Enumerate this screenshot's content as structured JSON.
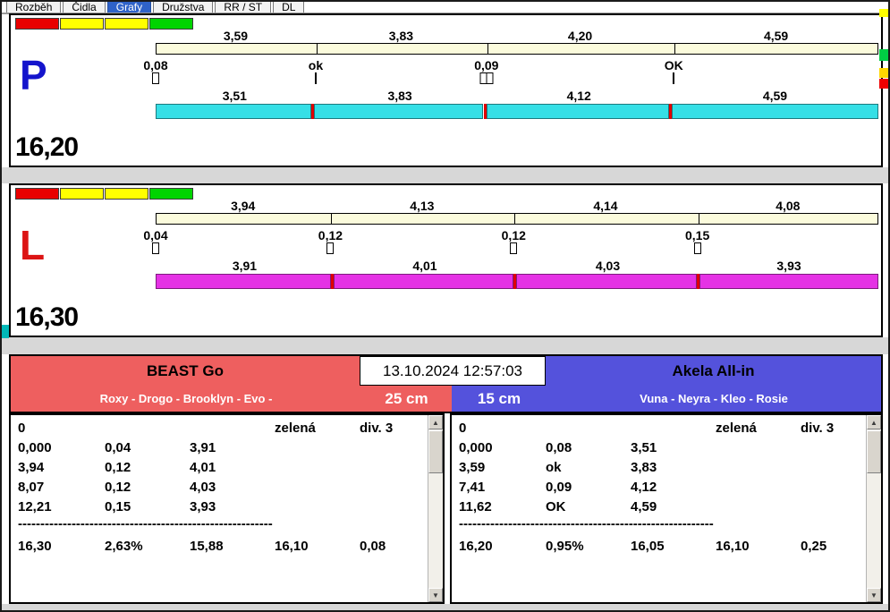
{
  "tabs": {
    "items": [
      "Rozběh",
      "Čidla",
      "Grafy",
      "Družstva",
      "RR / ST",
      "DL"
    ],
    "selected_index": 2
  },
  "panels": [
    {
      "side": "P",
      "side_color": "#1414cc",
      "total": "16,20",
      "lights": [
        "#e80000",
        "#ffff00",
        "#ffff00",
        "#00d400"
      ],
      "reference_bar": {
        "color": "#fbfbdc",
        "segments": [
          {
            "label": "3,59",
            "value": 3.59
          },
          {
            "label": "3,83",
            "value": 3.83
          },
          {
            "label": "4,20",
            "value": 4.2
          },
          {
            "label": "4,59",
            "value": 4.59
          }
        ]
      },
      "gap_row": [
        {
          "label": "0,08",
          "mark": "box"
        },
        {
          "label": "ok",
          "mark": "tick"
        },
        {
          "label": "0,09",
          "mark": "dbox"
        },
        {
          "label": "OK",
          "mark": "tick"
        }
      ],
      "segment_bar": {
        "color": "#35dfe6",
        "divider_color": "#e00000",
        "segments": [
          {
            "label": "3,51",
            "value": 3.51
          },
          {
            "label": "3,83",
            "value": 3.83
          },
          {
            "label": "4,12",
            "value": 4.12
          },
          {
            "label": "4,59",
            "value": 4.59
          }
        ]
      }
    },
    {
      "side": "L",
      "side_color": "#dc1414",
      "total": "16,30",
      "lights": [
        "#e80000",
        "#ffff00",
        "#ffff00",
        "#00d400"
      ],
      "reference_bar": {
        "color": "#fbfbdc",
        "segments": [
          {
            "label": "3,94",
            "value": 3.94
          },
          {
            "label": "4,13",
            "value": 4.13
          },
          {
            "label": "4,14",
            "value": 4.14
          },
          {
            "label": "4,08",
            "value": 4.08
          }
        ]
      },
      "gap_row": [
        {
          "label": "0,04",
          "mark": "box"
        },
        {
          "label": "0,12",
          "mark": "box"
        },
        {
          "label": "0,12",
          "mark": "box"
        },
        {
          "label": "0,15",
          "mark": "box"
        }
      ],
      "segment_bar": {
        "color": "#e532e5",
        "divider_color": "#e00000",
        "segments": [
          {
            "label": "3,91",
            "value": 3.91
          },
          {
            "label": "4,01",
            "value": 4.01
          },
          {
            "label": "4,03",
            "value": 4.03
          },
          {
            "label": "3,93",
            "value": 3.93
          }
        ]
      }
    }
  ],
  "footer": {
    "datetime": "13.10.2024 12:57:03",
    "left_team": {
      "name": "BEAST Go",
      "members": "Roxy - Drogo - Brooklyn - Evo -",
      "jump_height": "25 cm",
      "color": "#ee5f5f"
    },
    "right_team": {
      "name": "Akela All-in",
      "members": "Vuna - Neyra - Kleo - Rosie",
      "jump_height": "15 cm",
      "color": "#5452dc"
    },
    "tables": [
      {
        "start": "0",
        "status": "zelená",
        "division": "div. 3",
        "rows": [
          [
            "0,000",
            "0,04",
            "3,91"
          ],
          [
            "3,94",
            "0,12",
            "4,01"
          ],
          [
            "8,07",
            "0,12",
            "4,03"
          ],
          [
            "12,21",
            "0,15",
            "3,93"
          ]
        ],
        "separator": "------------------------------------------------------------",
        "totals": [
          "16,30",
          "2,63%",
          "15,88",
          "16,10",
          "0,08"
        ]
      },
      {
        "start": "0",
        "status": "zelená",
        "division": "div. 3",
        "rows": [
          [
            "0,000",
            "0,08",
            "3,51"
          ],
          [
            "3,59",
            "ok",
            "3,83"
          ],
          [
            "7,41",
            "0,09",
            "4,12"
          ],
          [
            "11,62",
            "OK",
            "4,59"
          ]
        ],
        "separator": "------------------------------------------------------------",
        "totals": [
          "16,20",
          "0,95%",
          "16,05",
          "16,10",
          "0,25"
        ]
      }
    ]
  },
  "icons": {
    "scroll_up": "▲",
    "scroll_down": "▼"
  },
  "decor": {
    "right_strip": [
      "#ffff00",
      "#00cc44",
      "#ffd800",
      "#ee0000"
    ],
    "left_block": "#00b8b8"
  }
}
